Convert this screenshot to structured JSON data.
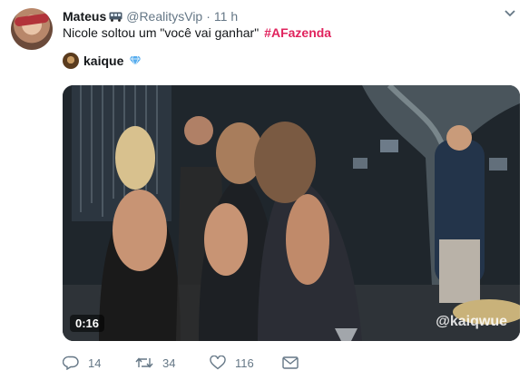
{
  "tweet": {
    "author": {
      "display_name": "Mateus",
      "handle": "@RealitysVip",
      "badge_icon": "bus-icon"
    },
    "separator": "·",
    "timestamp": "11 h",
    "text": "Nicole soltou um \"você vai ganhar\"",
    "hashtag": "#AFazenda",
    "quoted_user": {
      "name": "kaique",
      "badge_icon": "diamond-icon"
    },
    "media": {
      "duration": "0:16",
      "watermark": "@kaiqwue"
    },
    "actions": {
      "replies": "14",
      "retweets": "34",
      "likes": "116"
    }
  },
  "colors": {
    "hashtag": "#e0245e",
    "muted": "#657786",
    "diamond": "#55acee"
  }
}
